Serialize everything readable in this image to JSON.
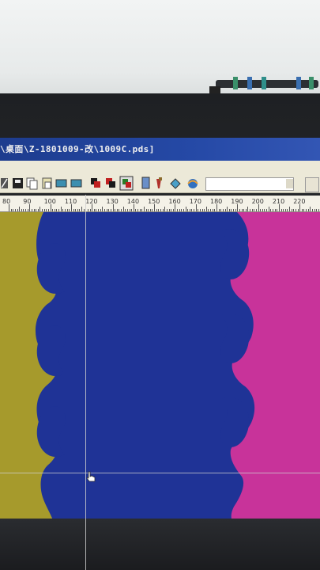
{
  "window": {
    "title": "\\桌面\\Z-1801009-改\\1009C.pds]"
  },
  "toolbar": {
    "icons": [
      "pen-icon",
      "save-icon",
      "copy-icon",
      "paste-icon",
      "layer-icon",
      "layer-icon",
      "color-swatch-icon",
      "color-swatch-icon",
      "color-swatch-icon",
      "document-icon",
      "brush-icon",
      "fill-icon",
      "globe-icon"
    ]
  },
  "ruler": {
    "labels": [
      "80",
      "90",
      "100",
      "110",
      "120",
      "130",
      "140",
      "150",
      "160",
      "170",
      "180",
      "190",
      "200",
      "210",
      "220"
    ]
  },
  "colors": {
    "left_panel": "#a69a2c",
    "center_panel": "#1f3396",
    "right_panel": "#c8339a",
    "title_bar": "#2549a6"
  }
}
